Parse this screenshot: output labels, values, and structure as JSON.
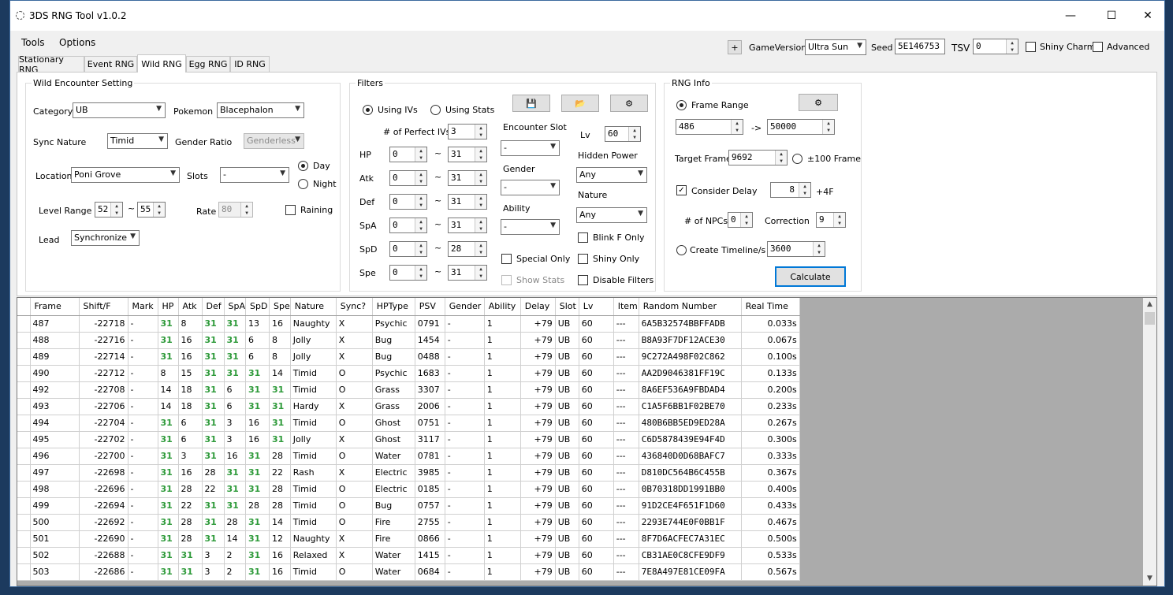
{
  "window": {
    "title": "3DS RNG Tool v1.0.2",
    "minimize": "—",
    "maximize": "☐",
    "close": "✕"
  },
  "menu": {
    "tools": "Tools",
    "options": "Options"
  },
  "tabs": [
    "Stationary RNG",
    "Event RNG",
    "Wild RNG",
    "Egg RNG",
    "ID RNG"
  ],
  "active_tab": "Wild RNG",
  "topbar": {
    "plus": "+",
    "game_version_label": "GameVersion",
    "game_version": "Ultra Sun",
    "seed_label": "Seed",
    "seed": "5E146753",
    "tsv_label": "TSV",
    "tsv": "0",
    "shiny_charm": "Shiny Charm",
    "advanced": "Advanced"
  },
  "wild": {
    "legend": "Wild Encounter Setting",
    "category_label": "Category",
    "category": "UB",
    "pokemon_label": "Pokemon",
    "pokemon": "Blacephalon",
    "sync_nature_label": "Sync Nature",
    "sync_nature": "Timid",
    "gender_ratio_label": "Gender Ratio",
    "gender_ratio": "Genderless",
    "location_label": "Location",
    "location": "Poni Grove",
    "slots_label": "Slots",
    "slots": "-",
    "day": "Day",
    "night": "Night",
    "level_range_label": "Level Range",
    "level_min": "52",
    "level_max": "55",
    "rate_label": "Rate",
    "rate": "80",
    "raining": "Raining",
    "lead_label": "Lead",
    "lead": "Synchronize",
    "tilde": "~"
  },
  "filters": {
    "legend": "Filters",
    "using_ivs": "Using IVs",
    "using_stats": "Using Stats",
    "perfect_ivs_label": "# of Perfect IVs",
    "perfect_ivs": "3",
    "stats": [
      {
        "label": "HP",
        "min": "0",
        "max": "31"
      },
      {
        "label": "Atk",
        "min": "0",
        "max": "31"
      },
      {
        "label": "Def",
        "min": "0",
        "max": "31"
      },
      {
        "label": "SpA",
        "min": "0",
        "max": "31"
      },
      {
        "label": "SpD",
        "min": "0",
        "max": "28"
      },
      {
        "label": "Spe",
        "min": "0",
        "max": "31"
      }
    ],
    "encounter_slot_label": "Encounter Slot",
    "encounter_slot": "-",
    "gender_label": "Gender",
    "gender": "-",
    "ability_label": "Ability",
    "ability": "-",
    "lv_label": "Lv",
    "lv": "60",
    "hidden_power_label": "Hidden Power",
    "hidden_power": "Any",
    "nature_label": "Nature",
    "nature": "Any",
    "blink_f_only": "Blink F Only",
    "special_only": "Special Only",
    "shiny_only": "Shiny Only",
    "show_stats": "Show Stats",
    "disable_filters": "Disable Filters"
  },
  "rnginfo": {
    "legend": "RNG Info",
    "frame_range": "Frame Range",
    "frame_min": "486",
    "arrow": "->",
    "frame_max": "50000",
    "target_frame_label": "Target Frame",
    "target_frame": "9692",
    "plus100": "±100 Frame",
    "consider_delay": "Consider Delay",
    "delay": "8",
    "plus4f": "+4F",
    "npcs_label": "# of NPCs",
    "npcs": "0",
    "correction_label": "Correction",
    "correction": "9",
    "create_timeline": "Create Timeline/s",
    "timeline": "3600",
    "calculate": "Calculate"
  },
  "grid": {
    "columns": [
      "Frame",
      "Shift/F",
      "Mark",
      "HP",
      "Atk",
      "Def",
      "SpA",
      "SpD",
      "Spe",
      "Nature",
      "Sync?",
      "HPType",
      "PSV",
      "Gender",
      "Ability",
      "Delay",
      "Slot",
      "Lv",
      "Item",
      "Random Number",
      "Real Time"
    ],
    "rows": [
      [
        "487",
        "-22718",
        "-",
        "31",
        "8",
        "31",
        "31",
        "13",
        "16",
        "Naughty",
        "X",
        "Psychic",
        "0791",
        "-",
        "1",
        "+79",
        "UB",
        "60",
        "---",
        "6A5B32574BBFFADB",
        "0.033s"
      ],
      [
        "488",
        "-22716",
        "-",
        "31",
        "16",
        "31",
        "31",
        "6",
        "8",
        "Jolly",
        "X",
        "Bug",
        "1454",
        "-",
        "1",
        "+79",
        "UB",
        "60",
        "---",
        "B8A93F7DF12ACE30",
        "0.067s"
      ],
      [
        "489",
        "-22714",
        "-",
        "31",
        "16",
        "31",
        "31",
        "6",
        "8",
        "Jolly",
        "X",
        "Bug",
        "0488",
        "-",
        "1",
        "+79",
        "UB",
        "60",
        "---",
        "9C272A498F02C862",
        "0.100s"
      ],
      [
        "490",
        "-22712",
        "-",
        "8",
        "15",
        "31",
        "31",
        "31",
        "14",
        "Timid",
        "O",
        "Psychic",
        "1683",
        "-",
        "1",
        "+79",
        "UB",
        "60",
        "---",
        "AA2D9046381FF19C",
        "0.133s"
      ],
      [
        "492",
        "-22708",
        "-",
        "14",
        "18",
        "31",
        "6",
        "31",
        "31",
        "Timid",
        "O",
        "Grass",
        "3307",
        "-",
        "1",
        "+79",
        "UB",
        "60",
        "---",
        "8A6EF536A9FBDAD4",
        "0.200s"
      ],
      [
        "493",
        "-22706",
        "-",
        "14",
        "18",
        "31",
        "6",
        "31",
        "31",
        "Hardy",
        "X",
        "Grass",
        "2006",
        "-",
        "1",
        "+79",
        "UB",
        "60",
        "---",
        "C1A5F6BB1F02BE70",
        "0.233s"
      ],
      [
        "494",
        "-22704",
        "-",
        "31",
        "6",
        "31",
        "3",
        "16",
        "31",
        "Timid",
        "O",
        "Ghost",
        "0751",
        "-",
        "1",
        "+79",
        "UB",
        "60",
        "---",
        "480B6BB5ED9ED28A",
        "0.267s"
      ],
      [
        "495",
        "-22702",
        "-",
        "31",
        "6",
        "31",
        "3",
        "16",
        "31",
        "Jolly",
        "X",
        "Ghost",
        "3117",
        "-",
        "1",
        "+79",
        "UB",
        "60",
        "---",
        "C6D5878439E94F4D",
        "0.300s"
      ],
      [
        "496",
        "-22700",
        "-",
        "31",
        "3",
        "31",
        "16",
        "31",
        "28",
        "Timid",
        "O",
        "Water",
        "0781",
        "-",
        "1",
        "+79",
        "UB",
        "60",
        "---",
        "436840D0D68BAFC7",
        "0.333s"
      ],
      [
        "497",
        "-22698",
        "-",
        "31",
        "16",
        "28",
        "31",
        "31",
        "22",
        "Rash",
        "X",
        "Electric",
        "3985",
        "-",
        "1",
        "+79",
        "UB",
        "60",
        "---",
        "D810DC564B6C455B",
        "0.367s"
      ],
      [
        "498",
        "-22696",
        "-",
        "31",
        "28",
        "22",
        "31",
        "31",
        "28",
        "Timid",
        "O",
        "Electric",
        "0185",
        "-",
        "1",
        "+79",
        "UB",
        "60",
        "---",
        "0B70318DD1991BB0",
        "0.400s"
      ],
      [
        "499",
        "-22694",
        "-",
        "31",
        "22",
        "31",
        "31",
        "28",
        "28",
        "Timid",
        "O",
        "Bug",
        "0757",
        "-",
        "1",
        "+79",
        "UB",
        "60",
        "---",
        "91D2CE4F651F1D60",
        "0.433s"
      ],
      [
        "500",
        "-22692",
        "-",
        "31",
        "28",
        "31",
        "28",
        "31",
        "14",
        "Timid",
        "O",
        "Fire",
        "2755",
        "-",
        "1",
        "+79",
        "UB",
        "60",
        "---",
        "2293E744E0F0BB1F",
        "0.467s"
      ],
      [
        "501",
        "-22690",
        "-",
        "31",
        "28",
        "31",
        "14",
        "31",
        "12",
        "Naughty",
        "X",
        "Fire",
        "0866",
        "-",
        "1",
        "+79",
        "UB",
        "60",
        "---",
        "8F7D6ACFEC7A31EC",
        "0.500s"
      ],
      [
        "502",
        "-22688",
        "-",
        "31",
        "31",
        "3",
        "2",
        "31",
        "16",
        "Relaxed",
        "X",
        "Water",
        "1415",
        "-",
        "1",
        "+79",
        "UB",
        "60",
        "---",
        "CB31AE0C8CFE9DF9",
        "0.533s"
      ],
      [
        "503",
        "-22686",
        "-",
        "31",
        "31",
        "3",
        "2",
        "31",
        "16",
        "Timid",
        "O",
        "Water",
        "0684",
        "-",
        "1",
        "+79",
        "UB",
        "60",
        "---",
        "7E8A497E81CE09FA",
        "0.567s"
      ]
    ]
  },
  "colors": {
    "perfect_iv": "#2e9a3a",
    "focus": "#0078d7"
  }
}
